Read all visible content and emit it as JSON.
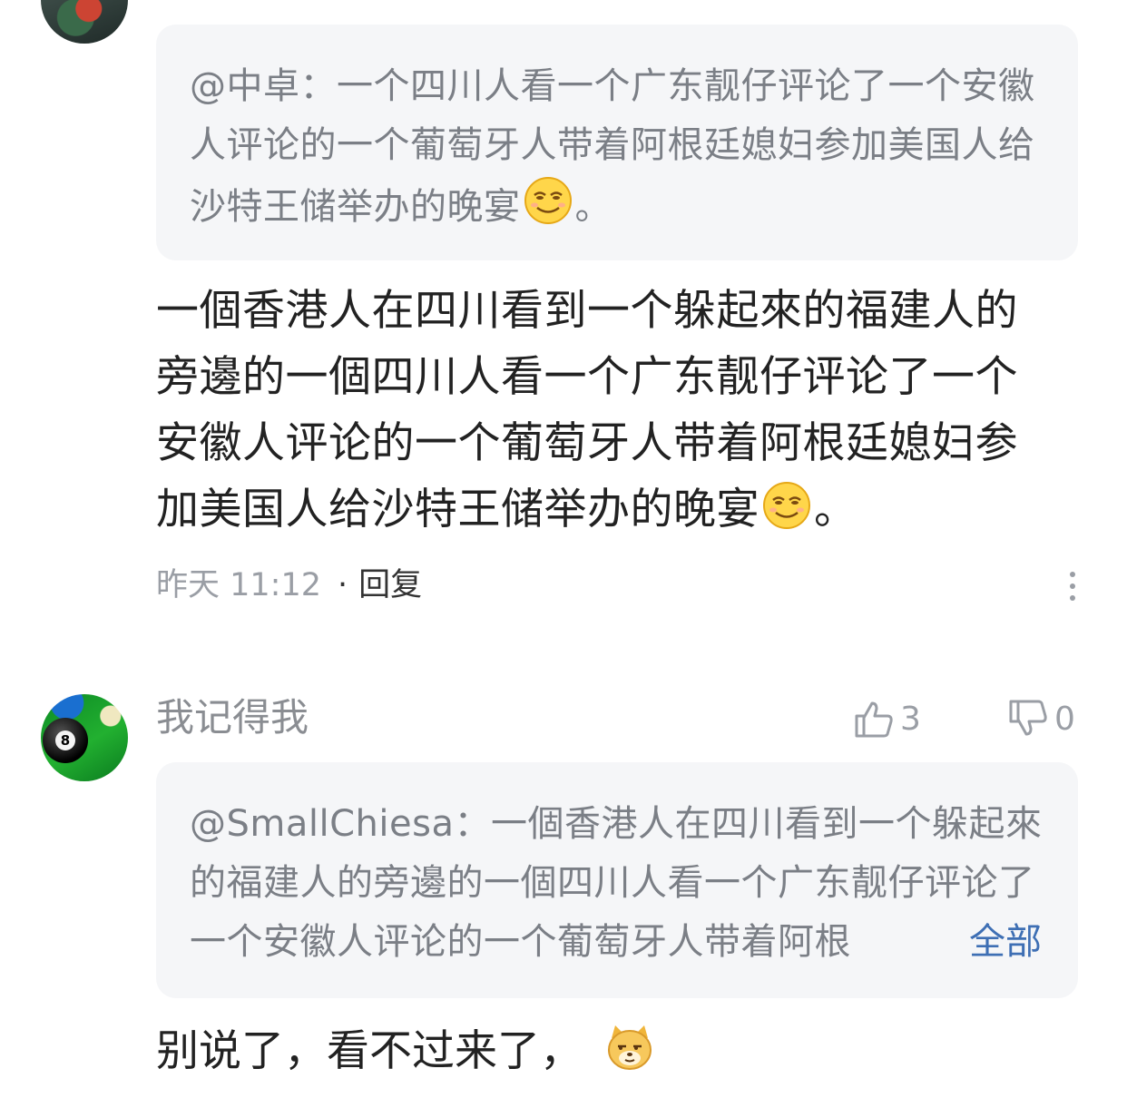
{
  "comment1": {
    "quote_text": "@中卓：一个四川人看一个广东靓仔评论了一个安徽人评论的一个葡萄牙人带着阿根廷媳妇参加美国人给沙特王储举办的晚宴",
    "quote_end": "。",
    "body_text": "一個香港人在四川看到一个躲起來的福建人的旁邊的一個四川人看一个广东靓仔评论了一个安徽人评论的一个葡萄牙人带着阿根廷媳妇参加美国人给沙特王储举办的晚宴",
    "body_end": "。",
    "time": "昨天 11:12",
    "separator": "·",
    "reply_label": "回复"
  },
  "comment2": {
    "username": "我记得我",
    "likes": "3",
    "dislikes": "0",
    "quote_text": "@SmallChiesa：一個香港人在四川看到一个躲起來的福建人的旁邊的一個四川人看一个广东靓仔评论了一个安徽人评论的一个葡萄牙人带着阿根",
    "more_label": "全部",
    "body_text": "别说了，看不过来了，"
  },
  "avatar2_ball_number": "8",
  "colors": {
    "link": "#3e6fb4",
    "muted": "#9a9ea5",
    "quote_bg": "#f5f6f8",
    "text": "#222222"
  },
  "icons": [
    "more-vertical-icon",
    "thumbs-up-icon",
    "thumbs-down-icon",
    "smirk-emoji-icon",
    "doge-emoji-icon"
  ]
}
